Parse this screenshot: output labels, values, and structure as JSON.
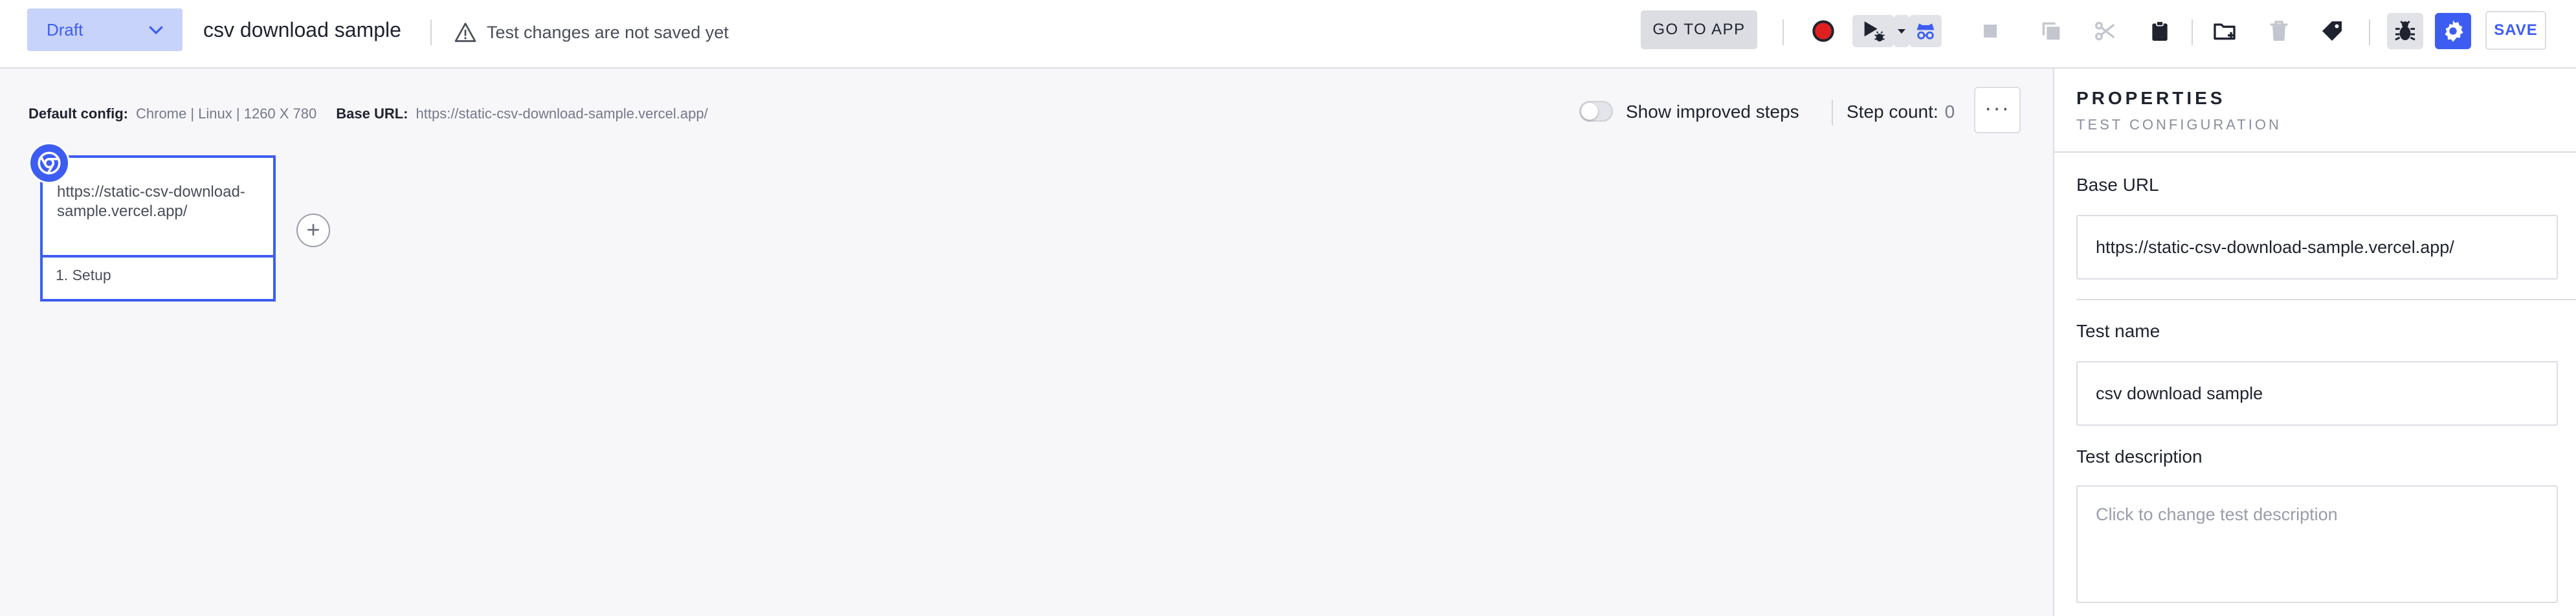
{
  "header": {
    "status": "Draft",
    "test_title": "csv download sample",
    "warning_text": "Test changes are not saved yet",
    "go_to_app_label": "GO TO APP",
    "save_label": "SAVE",
    "icons": [
      "record-icon",
      "run-bug-icon",
      "run-dropdown-icon",
      "incognito-icon",
      "stop-icon",
      "copy-icon",
      "cut-icon",
      "clipboard-icon",
      "new-folder-icon",
      "delete-icon",
      "tag-icon",
      "debug-icon",
      "settings-icon"
    ],
    "colors": {
      "accent": "#3d5df2",
      "record": "#e02020"
    }
  },
  "config": {
    "default_config_label": "Default config:",
    "default_config_value": "Chrome | Linux | 1260 X 780",
    "base_url_label": "Base URL:",
    "base_url_value": "https://static-csv-download-sample.vercel.app/",
    "show_improved_label": "Show improved steps",
    "step_count_label": "Step count:",
    "step_count_value": "0",
    "more_label": "···"
  },
  "step_card": {
    "url_text": "https://static-csv-download-sample.vercel.app/",
    "step_label": "1. Setup"
  },
  "properties": {
    "title": "PROPERTIES",
    "subtitle": "TEST CONFIGURATION",
    "base_url_label": "Base URL",
    "base_url_value": "https://static-csv-download-sample.vercel.app/",
    "test_name_label": "Test name",
    "test_name_value": "csv download sample",
    "description_label": "Test description",
    "description_placeholder": "Click to change test description"
  }
}
